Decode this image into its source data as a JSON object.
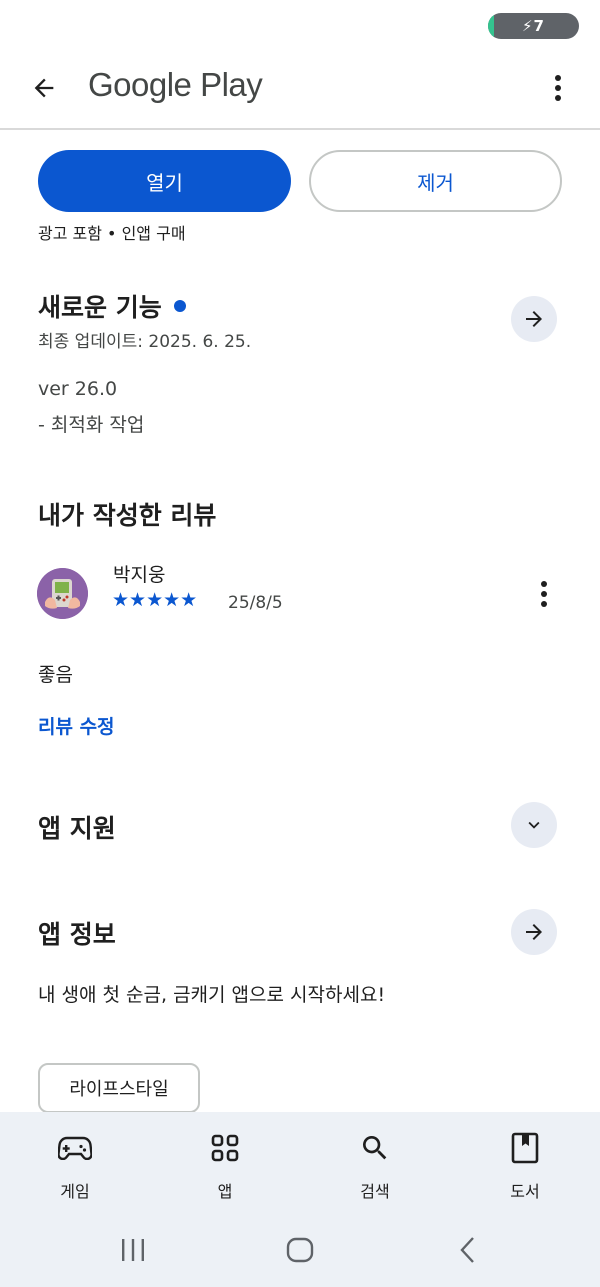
{
  "status_bar": {
    "battery_label": "⚡7",
    "battery_level": 0.07,
    "battery_color": "#34c38f"
  },
  "app_bar": {
    "title": "Google Play",
    "back_icon": "arrow-back-icon",
    "more_icon": "more-vert-icon"
  },
  "actions": {
    "open_label": "열기",
    "remove_label": "제거",
    "accent": "#0b57d0"
  },
  "meta_line": "광고 포함 • 인앱 구매",
  "whats_new": {
    "title": "새로운 기능",
    "updated": "최종 업데이트: 2025. 6. 25.",
    "version": "ver 26.0",
    "notes": "- 최적화 작업"
  },
  "my_review": {
    "title": "내가 작성한 리뷰",
    "reviewer": "박지웅",
    "stars": "★★★★★",
    "rating": 5,
    "date": "25/8/5",
    "text": "좋음",
    "edit_label": "리뷰 수정"
  },
  "app_support": {
    "title": "앱 지원"
  },
  "app_info": {
    "title": "앱 정보",
    "description": "내 생애 첫 순금, 금캐기 앱으로 시작하세요!"
  },
  "category_chip": "라이프스타일",
  "bottom_nav": [
    {
      "label": "게임",
      "icon": "gamepad-icon"
    },
    {
      "label": "앱",
      "icon": "apps-grid-icon"
    },
    {
      "label": "검색",
      "icon": "search-icon"
    },
    {
      "label": "도서",
      "icon": "book-icon"
    }
  ]
}
